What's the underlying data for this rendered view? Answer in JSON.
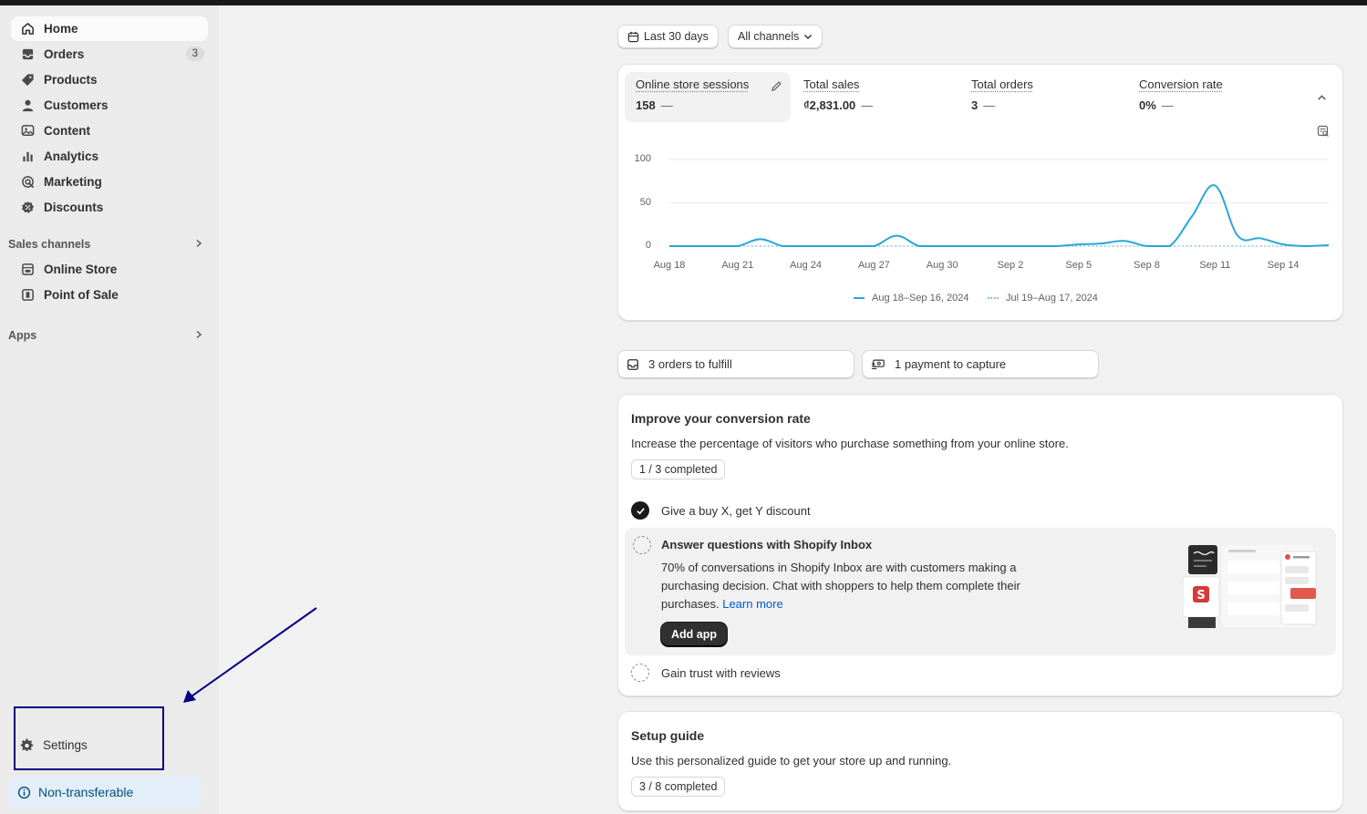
{
  "sidebar": {
    "items": [
      {
        "label": "Home",
        "icon": "home-icon"
      },
      {
        "label": "Orders",
        "icon": "inbox-icon",
        "badge": "3"
      },
      {
        "label": "Products",
        "icon": "tag-icon"
      },
      {
        "label": "Customers",
        "icon": "person-icon"
      },
      {
        "label": "Content",
        "icon": "image-icon"
      },
      {
        "label": "Analytics",
        "icon": "bar-chart-icon"
      },
      {
        "label": "Marketing",
        "icon": "target-icon"
      },
      {
        "label": "Discounts",
        "icon": "discount-icon"
      }
    ],
    "sales_channels": {
      "title": "Sales channels",
      "items": [
        {
          "label": "Online Store",
          "icon": "store-icon"
        },
        {
          "label": "Point of Sale",
          "icon": "pos-icon"
        }
      ]
    },
    "apps": {
      "title": "Apps"
    },
    "settings_label": "Settings",
    "non_transferable_label": "Non-transferable"
  },
  "filters": {
    "date_range": "Last 30 days",
    "channels": "All channels"
  },
  "metrics": [
    {
      "label": "Online store sessions",
      "value": "158",
      "trend": "—"
    },
    {
      "label": "Total sales",
      "value": "₫2,831.00",
      "trend": "—"
    },
    {
      "label": "Total orders",
      "value": "3",
      "trend": "—"
    },
    {
      "label": "Conversion rate",
      "value": "0%",
      "trend": "—"
    }
  ],
  "chart_data": {
    "type": "line",
    "x": [
      "Aug 18",
      "Aug 19",
      "Aug 20",
      "Aug 21",
      "Aug 22",
      "Aug 23",
      "Aug 24",
      "Aug 25",
      "Aug 26",
      "Aug 27",
      "Aug 28",
      "Aug 29",
      "Aug 30",
      "Aug 31",
      "Sep 1",
      "Sep 2",
      "Sep 3",
      "Sep 4",
      "Sep 5",
      "Sep 6",
      "Sep 7",
      "Sep 8",
      "Sep 9",
      "Sep 10",
      "Sep 11",
      "Sep 12",
      "Sep 13",
      "Sep 14",
      "Sep 15",
      "Sep 16"
    ],
    "xticks": [
      "Aug 18",
      "Aug 21",
      "Aug 24",
      "Aug 27",
      "Aug 30",
      "Sep 2",
      "Sep 5",
      "Sep 8",
      "Sep 11",
      "Sep 14"
    ],
    "series": [
      {
        "name": "Aug 18–Sep 16, 2024",
        "values": [
          0,
          0,
          0,
          0,
          8,
          0,
          0,
          0,
          0,
          0,
          12,
          0,
          0,
          0,
          0,
          0,
          0,
          0,
          2,
          3,
          6,
          0,
          0,
          35,
          70,
          12,
          9,
          2,
          0,
          1
        ]
      },
      {
        "name": "Jul 19–Aug 17, 2024",
        "values": [
          0,
          0,
          0,
          0,
          0,
          0,
          0,
          0,
          0,
          0,
          0,
          0,
          0,
          0,
          0,
          0,
          0,
          0,
          0,
          0,
          0,
          0,
          0,
          0,
          0,
          0,
          0,
          0,
          0,
          0
        ]
      }
    ],
    "yticks": [
      0,
      50,
      100
    ],
    "ylim": [
      0,
      100
    ],
    "grid": true,
    "legend": "bottom"
  },
  "tasks": {
    "orders": "3 orders to fulfill",
    "payments": "1 payment to capture"
  },
  "conversion_card": {
    "title": "Improve your conversion rate",
    "desc": "Increase the percentage of visitors who purchase something from your online store.",
    "progress": "1 / 3 completed",
    "step1": "Give a buy X, get Y discount",
    "step2_title": "Answer questions with Shopify Inbox",
    "step2_body": "70% of conversations in Shopify Inbox are with customers making a purchasing decision. Chat with shoppers to help them complete their purchases.",
    "step2_link": "Learn more",
    "step2_button": "Add app",
    "step3": "Gain trust with reviews"
  },
  "setup_card": {
    "title": "Setup guide",
    "desc": "Use this personalized guide to get your store up and running.",
    "progress": "3 / 8 completed"
  },
  "colors": {
    "accent_line": "#29a7d6",
    "annotation": "#000080",
    "link": "#005bd3"
  }
}
